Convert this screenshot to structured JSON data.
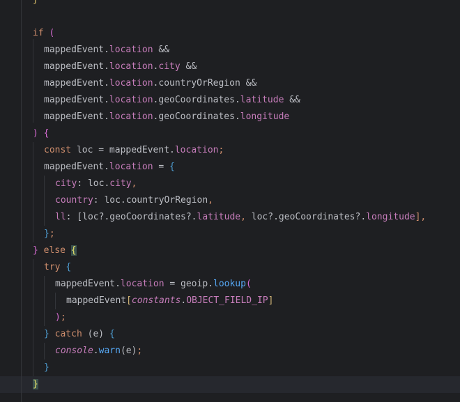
{
  "code": {
    "lines": [
      {
        "indent": 0,
        "tokens": [
          {
            "t": "}",
            "c": "br1"
          }
        ]
      },
      {
        "indent": 0,
        "tokens": []
      },
      {
        "indent": 0,
        "tokens": [
          {
            "t": "if",
            "c": "kw"
          },
          {
            "t": " ",
            "c": "pun"
          },
          {
            "t": "(",
            "c": "br2"
          }
        ]
      },
      {
        "indent": 1,
        "tokens": [
          {
            "t": "mappedEvent",
            "c": "id"
          },
          {
            "t": ".",
            "c": "pun"
          },
          {
            "t": "location",
            "c": "prop"
          },
          {
            "t": " &&",
            "c": "pun"
          }
        ]
      },
      {
        "indent": 1,
        "tokens": [
          {
            "t": "mappedEvent",
            "c": "id"
          },
          {
            "t": ".",
            "c": "pun"
          },
          {
            "t": "location",
            "c": "prop"
          },
          {
            "t": ".",
            "c": "pun"
          },
          {
            "t": "city",
            "c": "prop"
          },
          {
            "t": " &&",
            "c": "pun"
          }
        ]
      },
      {
        "indent": 1,
        "tokens": [
          {
            "t": "mappedEvent",
            "c": "id"
          },
          {
            "t": ".",
            "c": "pun"
          },
          {
            "t": "location",
            "c": "prop"
          },
          {
            "t": ".",
            "c": "pun"
          },
          {
            "t": "countryOrRegion",
            "c": "id"
          },
          {
            "t": " &&",
            "c": "pun"
          }
        ]
      },
      {
        "indent": 1,
        "tokens": [
          {
            "t": "mappedEvent",
            "c": "id"
          },
          {
            "t": ".",
            "c": "pun"
          },
          {
            "t": "location",
            "c": "prop"
          },
          {
            "t": ".",
            "c": "pun"
          },
          {
            "t": "geoCoordinates",
            "c": "id"
          },
          {
            "t": ".",
            "c": "pun"
          },
          {
            "t": "latitude",
            "c": "prop"
          },
          {
            "t": " &&",
            "c": "pun"
          }
        ]
      },
      {
        "indent": 1,
        "tokens": [
          {
            "t": "mappedEvent",
            "c": "id"
          },
          {
            "t": ".",
            "c": "pun"
          },
          {
            "t": "location",
            "c": "prop"
          },
          {
            "t": ".",
            "c": "pun"
          },
          {
            "t": "geoCoordinates",
            "c": "id"
          },
          {
            "t": ".",
            "c": "pun"
          },
          {
            "t": "longitude",
            "c": "prop"
          }
        ]
      },
      {
        "indent": 0,
        "tokens": [
          {
            "t": ")",
            "c": "br2"
          },
          {
            "t": " ",
            "c": "pun"
          },
          {
            "t": "{",
            "c": "br2"
          }
        ]
      },
      {
        "indent": 1,
        "tokens": [
          {
            "t": "const",
            "c": "kw"
          },
          {
            "t": " loc = mappedEvent",
            "c": "id"
          },
          {
            "t": ".",
            "c": "pun"
          },
          {
            "t": "location",
            "c": "prop"
          },
          {
            "t": ";",
            "c": "kw"
          }
        ]
      },
      {
        "indent": 1,
        "tokens": [
          {
            "t": "mappedEvent",
            "c": "id"
          },
          {
            "t": ".",
            "c": "pun"
          },
          {
            "t": "location",
            "c": "prop"
          },
          {
            "t": " = ",
            "c": "pun"
          },
          {
            "t": "{",
            "c": "br3"
          }
        ]
      },
      {
        "indent": 2,
        "tokens": [
          {
            "t": "city",
            "c": "prop"
          },
          {
            "t": ": loc.",
            "c": "id"
          },
          {
            "t": "city",
            "c": "prop"
          },
          {
            "t": ",",
            "c": "kw"
          }
        ]
      },
      {
        "indent": 2,
        "tokens": [
          {
            "t": "country",
            "c": "prop"
          },
          {
            "t": ": loc.countryOrRegion",
            "c": "id"
          },
          {
            "t": ",",
            "c": "kw"
          }
        ]
      },
      {
        "indent": 2,
        "tokens": [
          {
            "t": "ll",
            "c": "prop"
          },
          {
            "t": ": [loc?.geoCoordinates?.",
            "c": "id"
          },
          {
            "t": "latitude",
            "c": "prop"
          },
          {
            "t": ", ",
            "c": "kw"
          },
          {
            "t": "loc?.geoCoordinates?.",
            "c": "id"
          },
          {
            "t": "longitude",
            "c": "prop"
          },
          {
            "t": "],",
            "c": "kw"
          }
        ]
      },
      {
        "indent": 1,
        "tokens": [
          {
            "t": "}",
            "c": "br3"
          },
          {
            "t": ";",
            "c": "kw"
          }
        ]
      },
      {
        "indent": 0,
        "tokens": [
          {
            "t": "}",
            "c": "br2"
          },
          {
            "t": " ",
            "c": "pun"
          },
          {
            "t": "else",
            "c": "kw"
          },
          {
            "t": " ",
            "c": "pun"
          },
          {
            "t": "{",
            "c": "brMatch"
          }
        ]
      },
      {
        "indent": 1,
        "tokens": [
          {
            "t": "try",
            "c": "kw"
          },
          {
            "t": " ",
            "c": "pun"
          },
          {
            "t": "{",
            "c": "br3"
          }
        ]
      },
      {
        "indent": 2,
        "tokens": [
          {
            "t": "mappedEvent",
            "c": "id"
          },
          {
            "t": ".",
            "c": "pun"
          },
          {
            "t": "location",
            "c": "prop"
          },
          {
            "t": " = geoip.",
            "c": "id"
          },
          {
            "t": "lookup",
            "c": "fn"
          },
          {
            "t": "(",
            "c": "br2"
          }
        ]
      },
      {
        "indent": 3,
        "tokens": [
          {
            "t": "mappedEvent",
            "c": "id"
          },
          {
            "t": "[",
            "c": "gold"
          },
          {
            "t": "constants",
            "c": "const ital"
          },
          {
            "t": ".",
            "c": "pun"
          },
          {
            "t": "OBJECT_FIELD_IP",
            "c": "prop"
          },
          {
            "t": "]",
            "c": "gold"
          }
        ]
      },
      {
        "indent": 2,
        "tokens": [
          {
            "t": ")",
            "c": "br2"
          },
          {
            "t": ";",
            "c": "kw"
          }
        ]
      },
      {
        "indent": 1,
        "tokens": [
          {
            "t": "}",
            "c": "br3"
          },
          {
            "t": " ",
            "c": "pun"
          },
          {
            "t": "catch",
            "c": "kw"
          },
          {
            "t": " (e) ",
            "c": "id"
          },
          {
            "t": "{",
            "c": "br3"
          }
        ]
      },
      {
        "indent": 2,
        "tokens": [
          {
            "t": "console",
            "c": "const ital"
          },
          {
            "t": ".",
            "c": "pun"
          },
          {
            "t": "warn",
            "c": "fn"
          },
          {
            "t": "(e)",
            "c": "id"
          },
          {
            "t": ";",
            "c": "kw"
          }
        ]
      },
      {
        "indent": 1,
        "tokens": [
          {
            "t": "}",
            "c": "br3"
          }
        ]
      },
      {
        "indent": 0,
        "tokens": [
          {
            "t": "}",
            "c": "brMatch"
          }
        ],
        "current": true
      }
    ]
  }
}
